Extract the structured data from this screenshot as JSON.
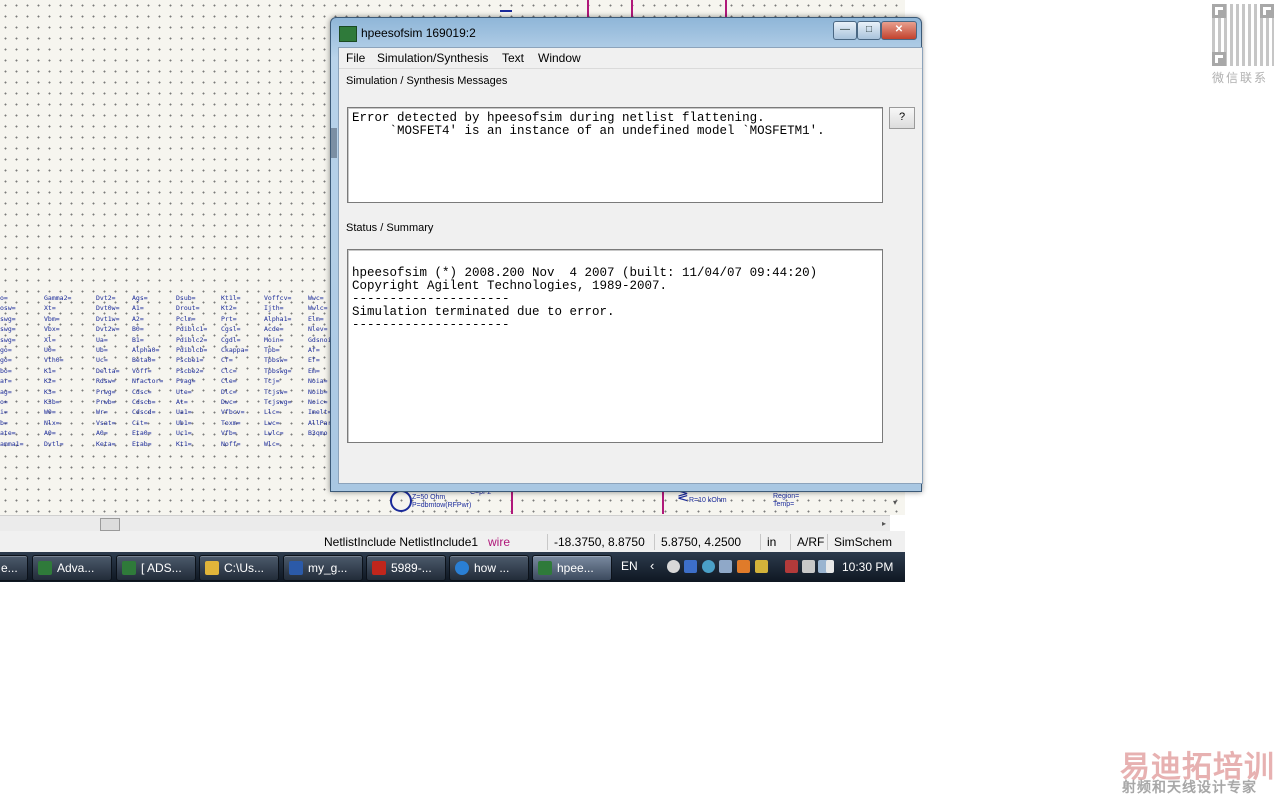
{
  "window": {
    "title": "hpeesofsim 169019:2",
    "menus": [
      "File",
      "Simulation/Synthesis",
      "Text",
      "Window"
    ],
    "messages_label": "Simulation / Synthesis Messages",
    "messages_text": "Error detected by hpeesofsim during netlist flattening.\n     `MOSFET4' is an instance of an undefined model `MOSFETM1'.",
    "help_label": "?",
    "status_label": "Status / Summary",
    "status_text": "\nhpeesofsim (*) 2008.200 Nov  4 2007 (built: 11/04/07 09:44:20)\nCopyright Agilent Technologies, 1989-2007.\n---------------------\nSimulation terminated due to error.\n---------------------"
  },
  "schematic": {
    "param_columns": [
      [
        "o=",
        "osw=",
        "swg=",
        "swg=",
        "swg=",
        "go=",
        "go=",
        "bo=",
        "ar=",
        "ag=",
        "o=",
        "i=",
        "b=",
        "ate=",
        "amma1="
      ],
      [
        "Gamma2=",
        "Xt=",
        "Vbm=",
        "Vbx=",
        "Xl=",
        "U0=",
        "Vth0=",
        "K1=",
        "K2=",
        "K3=",
        "K3b=",
        "W0=",
        "Nlx=",
        "A0=",
        "Dvtl="
      ],
      [
        "Dvt2=",
        "Dvt0w=",
        "Dvt1w=",
        "Dvt2w=",
        "Ua=",
        "Ub=",
        "Uc=",
        "Delta=",
        "Rdsw=",
        "Prwg=",
        "Prwb=",
        "Wr=",
        "Vsat=",
        "A0=",
        "Keta="
      ],
      [
        "Ags=",
        "A1=",
        "A2=",
        "B0=",
        "B1=",
        "Alpha0=",
        "Beta0=",
        "Voff=",
        "Nfactor=",
        "Cdsc=",
        "Cdscb=",
        "Cdscd=",
        "Cit=",
        "Eta0=",
        "Etab="
      ],
      [
        "Dsub=",
        "Drout=",
        "Pclm=",
        "Pdiblc1=",
        "Pdiblc2=",
        "Pdiblcb=",
        "Pscbe1=",
        "Pscbe2=",
        "Pvag=",
        "Ute=",
        "At=",
        "Ua1=",
        "Ub1=",
        "Uc1=",
        "Kt1="
      ],
      [
        "Kt1l=",
        "Kt2=",
        "Prt=",
        "Cgsl=",
        "Cgdl=",
        "Ckappa=",
        "Cf=",
        "Clc=",
        "Cle=",
        "Dlc=",
        "Dwc=",
        "Vfbcv=",
        "Toxm=",
        "Vfb=",
        "Noff="
      ],
      [
        "Voffcv=",
        "Ijth=",
        "Alpha1=",
        "Acde=",
        "Moin=",
        "Tpb=",
        "Tpbsw=",
        "Tpbswg=",
        "Tcj=",
        "Tcjsw=",
        "Tcjswg=",
        "Llc=",
        "Lwc=",
        "Lwlc=",
        "Wlc="
      ],
      [
        "Wwc=",
        "Wwlc=",
        "Elm=",
        "Nlev=",
        "Gdsnoi",
        "Af=",
        "Ef=",
        "Em=",
        "Noia=",
        "Noib=",
        "Noic=",
        "Imelt=",
        "AllPara",
        "B3qmo",
        ""
      ]
    ],
    "bottom_components": [
      "Z=50 Ohm\nP=dbmtow(RFPwr)",
      "C=pF2",
      "R=10 kOhm",
      "Region=\nTemp="
    ]
  },
  "statusbar": {
    "cells": [
      "NetlistInclude NetlistInclude1",
      "wire",
      "-18.3750, 8.8750",
      "5.8750, 4.2500",
      "in",
      "A/RF",
      "SimSchem"
    ]
  },
  "taskbar": {
    "buttons": [
      {
        "label": "e...",
        "icon_color": "#3a6ea5"
      },
      {
        "label": "Adva...",
        "icon_color": "#2f7a3a"
      },
      {
        "label": "[ ADS...",
        "icon_color": "#2f7a3a"
      },
      {
        "label": "C:\\Us...",
        "icon_color": "#e0b43a"
      },
      {
        "label": "my_g...",
        "icon_color": "#2b5aa8"
      },
      {
        "label": "5989-...",
        "icon_color": "#c0261c"
      },
      {
        "label": "how ...",
        "icon_color": "#2a7fd4"
      },
      {
        "label": "hpee...",
        "icon_color": "#2f7a3a"
      }
    ],
    "language": "EN",
    "tray_chevron": "‹",
    "clock": "10:30 PM"
  },
  "watermark": {
    "qr_caption": "微信联系",
    "brand": "易迪拓培训",
    "subtitle": "射频和天线设计专家"
  }
}
